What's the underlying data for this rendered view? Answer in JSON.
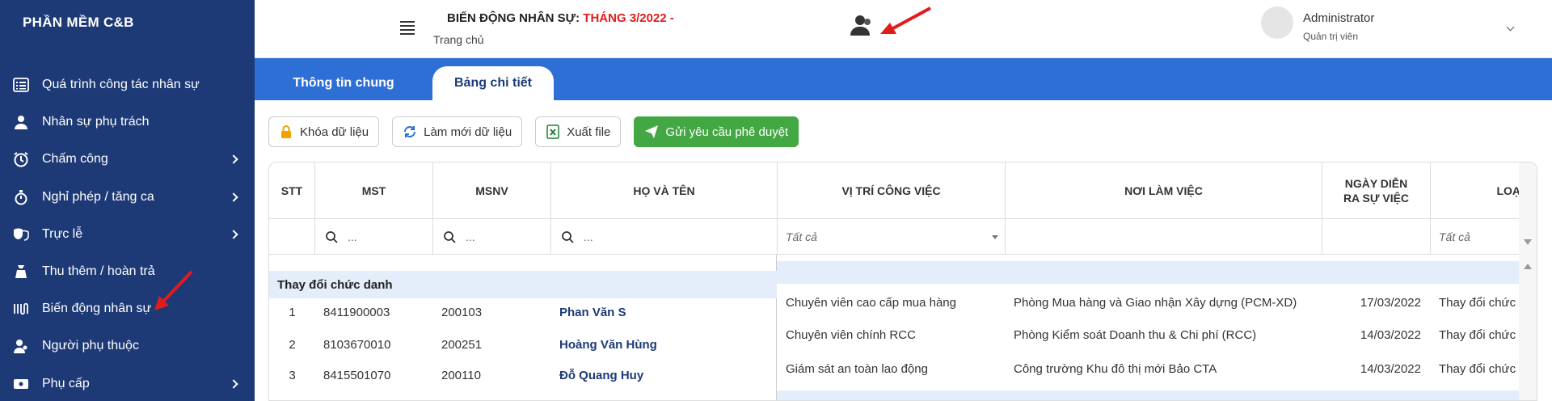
{
  "app": {
    "brand": "PHẦN MỀM C&B"
  },
  "sidebar": {
    "items": [
      {
        "label": "Quá trình công tác nhân sự",
        "icon": "list-icon",
        "has_children": false
      },
      {
        "label": "Nhân sự phụ trách",
        "icon": "user-tie-icon",
        "has_children": false
      },
      {
        "label": "Chấm công",
        "icon": "clock-icon",
        "has_children": true
      },
      {
        "label": "Nghỉ phép / tăng ca",
        "icon": "stopwatch-icon",
        "has_children": true
      },
      {
        "label": "Trực lễ",
        "icon": "theater-mask-icon",
        "has_children": true
      },
      {
        "label": "Thu thêm / hoàn trả",
        "icon": "money-bag-icon",
        "has_children": false
      },
      {
        "label": "Biến động nhân sự",
        "icon": "wave-icon",
        "has_children": false
      },
      {
        "label": "Người phụ thuộc",
        "icon": "dependents-icon",
        "has_children": false
      },
      {
        "label": "Phụ cấp",
        "icon": "allowance-icon",
        "has_children": true
      }
    ]
  },
  "header": {
    "title_prefix": "BIẾN ĐỘNG NHÂN SỰ: ",
    "title_month": "THÁNG 3/2022",
    "title_suffix": " -",
    "breadcrumb": "Trang chủ",
    "user_name": "Administrator",
    "user_role": "Quản trị viên"
  },
  "tabs": [
    {
      "label": "Thông tin chung",
      "active": false
    },
    {
      "label": "Bảng chi tiết",
      "active": true
    }
  ],
  "toolbar": {
    "lock_label": "Khóa dữ liệu",
    "refresh_label": "Làm mới dữ liệu",
    "export_label": "Xuất file",
    "submit_label": "Gửi yêu cầu phê duyệt"
  },
  "table": {
    "columns": [
      "STT",
      "MST",
      "MSNV",
      "HỌ VÀ TÊN",
      "VỊ TRÍ CÔNG VIỆC",
      "NƠI LÀM VIỆC",
      "NGÀY DIỄN RA SỰ VIỆC",
      "LOẠ"
    ],
    "filters": {
      "search_placeholder": "...",
      "all_label": "Tất cả"
    },
    "group_label": "Thay đổi chức danh",
    "rows": [
      {
        "stt": "1",
        "mst": "8411900003",
        "msnv": "200103",
        "name": "Phan Văn S",
        "position": "Chuyên viên cao cấp mua hàng",
        "workplace": "Phòng Mua hàng và Giao nhận Xây dựng (PCM-XD)",
        "date": "17/03/2022",
        "type": "Thay đổi chức"
      },
      {
        "stt": "2",
        "mst": "8103670010",
        "msnv": "200251",
        "name": "Hoàng Văn Hùng",
        "position": "Chuyên viên chính RCC",
        "workplace": "Phòng Kiểm soát Doanh thu & Chi phí (RCC)",
        "date": "14/03/2022",
        "type": "Thay đổi chức"
      },
      {
        "stt": "3",
        "mst": "8415501070",
        "msnv": "200110",
        "name": "Đỗ Quang Huy",
        "position": "Giám sát an toàn lao động",
        "workplace": "Công trường Khu đô thị mới Bảo CTA",
        "date": "14/03/2022",
        "type": "Thay đổi chức"
      }
    ]
  }
}
